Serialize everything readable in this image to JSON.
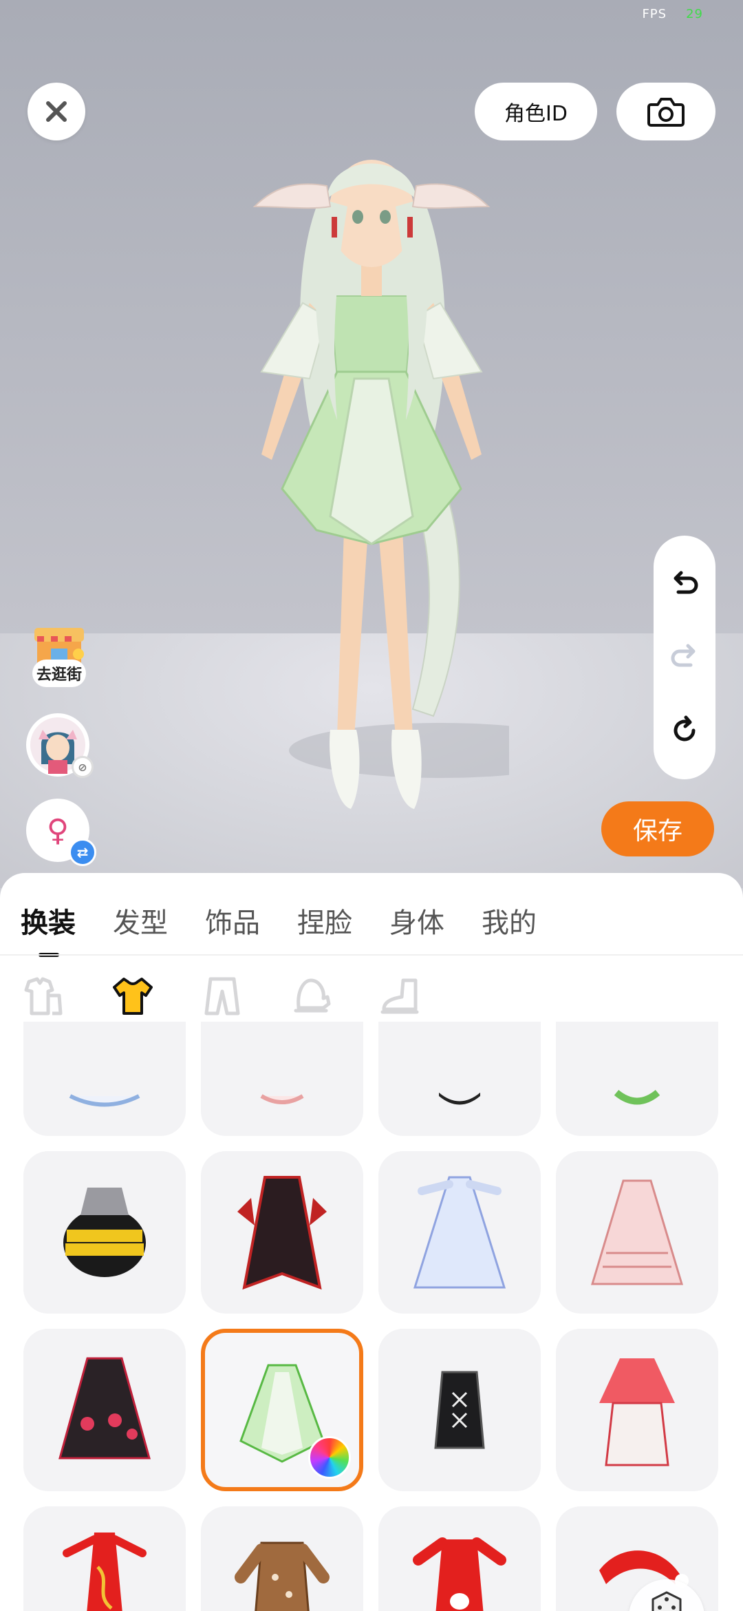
{
  "status": {
    "fps_label": "FPS",
    "fps_value": "29"
  },
  "header": {
    "role_id_label": "角色ID",
    "close_icon": "close-icon",
    "camera_icon": "camera-icon"
  },
  "side": {
    "shop_label": "去逛街",
    "gender_symbol": "♀",
    "swap_symbol": "⇄"
  },
  "history": {
    "undo_icon": "undo-icon",
    "redo_icon": "redo-icon",
    "reset_icon": "reset-icon"
  },
  "actions": {
    "save_label": "保存"
  },
  "tabs": [
    {
      "label": "换装",
      "active": true
    },
    {
      "label": "发型",
      "active": false
    },
    {
      "label": "饰品",
      "active": false
    },
    {
      "label": "捏脸",
      "active": false
    },
    {
      "label": "身体",
      "active": false
    },
    {
      "label": "我的",
      "active": false
    }
  ],
  "subcategories": [
    {
      "icon": "outfit-set-icon",
      "active": false
    },
    {
      "icon": "top-shirt-icon",
      "active": true
    },
    {
      "icon": "pants-icon",
      "active": false
    },
    {
      "icon": "glove-icon",
      "active": false
    },
    {
      "icon": "shoe-icon",
      "active": false
    }
  ],
  "items": [
    {
      "name": "white-lace-dress"
    },
    {
      "name": "pink-ruffle-top"
    },
    {
      "name": "black-outfit"
    },
    {
      "name": "green-outfit"
    },
    {
      "name": "bee-costume"
    },
    {
      "name": "red-black-coat"
    },
    {
      "name": "blue-white-gown"
    },
    {
      "name": "pink-lolita-dress"
    },
    {
      "name": "black-rose-dress"
    },
    {
      "name": "green-petal-dress",
      "selected": true
    },
    {
      "name": "black-corset"
    },
    {
      "name": "red-white-hanfu"
    },
    {
      "name": "red-qipao"
    },
    {
      "name": "brown-fawn-coat"
    },
    {
      "name": "red-bunny-qipao"
    },
    {
      "name": "santa-outfit"
    }
  ],
  "random": {
    "label": "随机"
  },
  "colors": {
    "accent": "#f47a19",
    "selected_border": "#f47a19",
    "badge_blue": "#3b8df0"
  }
}
